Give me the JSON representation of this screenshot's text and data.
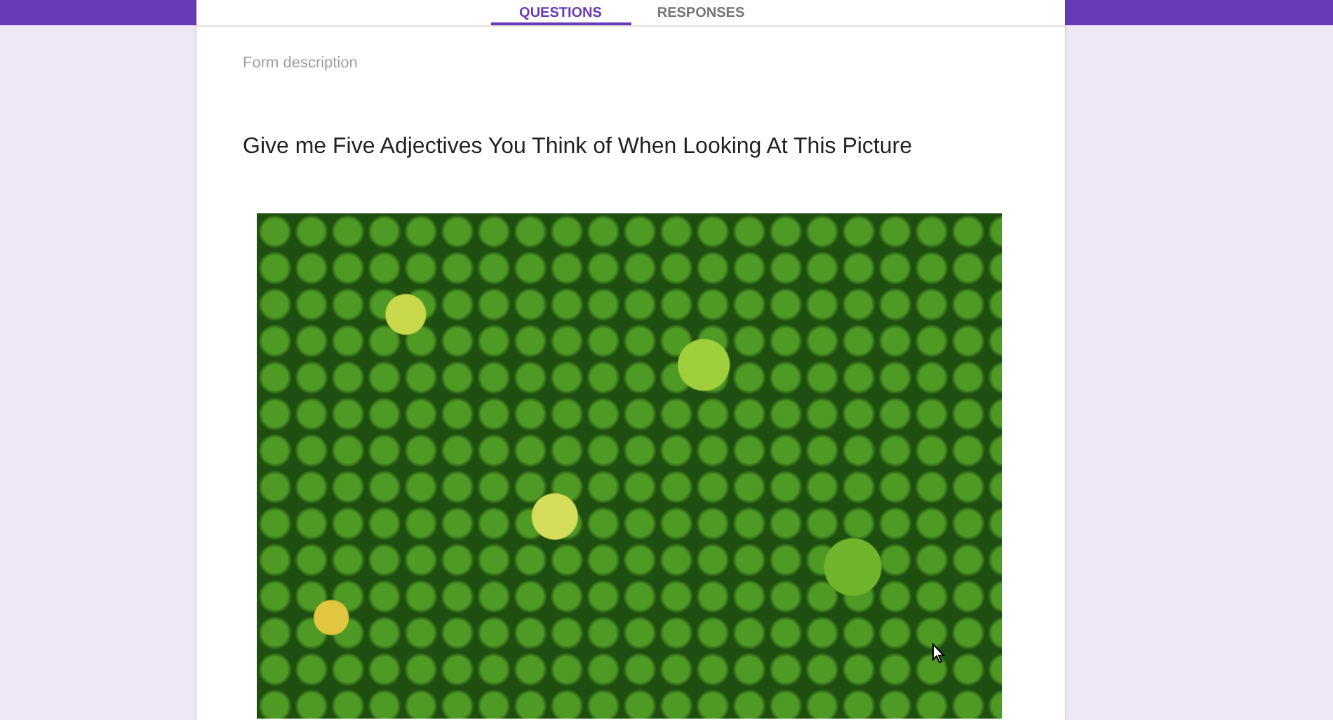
{
  "tabs": [
    {
      "label": "QUESTIONS",
      "selected": true
    },
    {
      "label": "RESPONSES",
      "selected": false
    }
  ],
  "form": {
    "description_placeholder": "Form description"
  },
  "question": {
    "title": "Give me Five Adjectives You Think of When Looking At This Picture"
  }
}
